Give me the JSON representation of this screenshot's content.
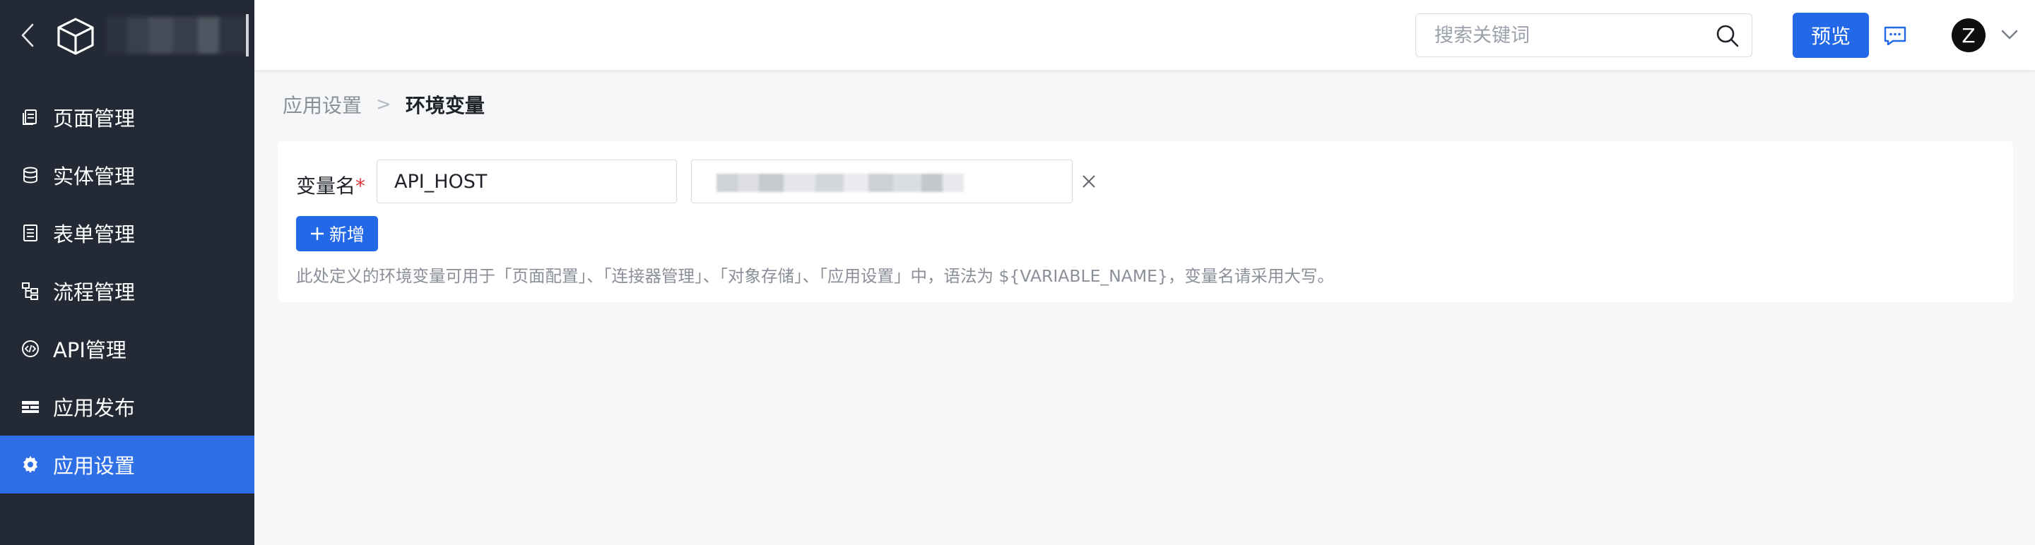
{
  "sidebar": {
    "app_name": "",
    "items": [
      {
        "label": "页面管理",
        "icon": "pages-icon"
      },
      {
        "label": "实体管理",
        "icon": "database-icon"
      },
      {
        "label": "表单管理",
        "icon": "form-icon"
      },
      {
        "label": "流程管理",
        "icon": "flow-icon"
      },
      {
        "label": "API管理",
        "icon": "api-icon"
      },
      {
        "label": "应用发布",
        "icon": "publish-icon"
      },
      {
        "label": "应用设置",
        "icon": "gear-icon",
        "active": true
      }
    ]
  },
  "header": {
    "search_placeholder": "搜索关键词",
    "preview_label": "预览",
    "avatar_letter": "Z"
  },
  "breadcrumb": {
    "parent": "应用设置",
    "separator": ">",
    "current": "环境变量"
  },
  "env_form": {
    "field_label": "变量名",
    "required_mark": "*",
    "name_value": "API_HOST",
    "value_value": "",
    "add_label": "新增",
    "hint": "此处定义的环境变量可用于「页面配置」、「连接器管理」、「对象存储」、「应用设置」中，语法为 ${VARIABLE_NAME}，变量名请采用大写。"
  },
  "colors": {
    "sidebar_bg": "#242a35",
    "accent": "#2368e6",
    "active_item": "#2f6fe6",
    "page_bg": "#f6f7f9",
    "required": "#e0383a"
  }
}
